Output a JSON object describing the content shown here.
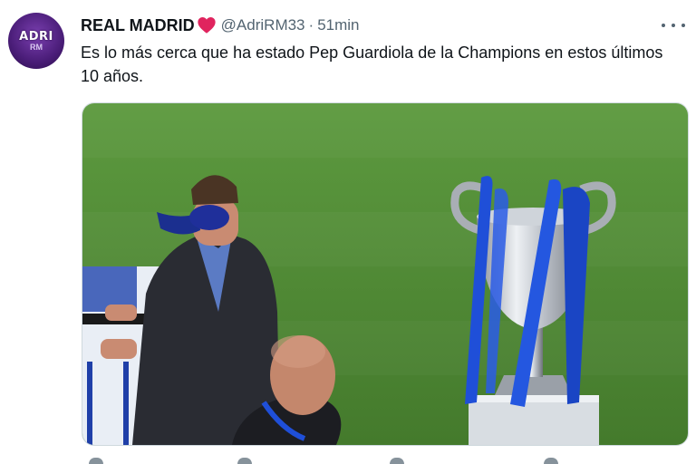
{
  "tweet": {
    "author_name": "REAL MADRID",
    "handle": "@AdriRM33",
    "separator": "·",
    "time": "51min",
    "text": "Es lo más cerca que ha estado Pep Guardiola de la Champions en estos últimos 10 años.",
    "avatar_text": "ADRI",
    "avatar_subtext": "RM"
  },
  "colors": {
    "heart": "#e0245e",
    "pitch": "#4f8a34",
    "ribbon": "#1f4fd8",
    "muted": "#536471"
  },
  "icons": [
    "heart-icon",
    "more-options-icon",
    "reply-icon",
    "retweet-icon",
    "like-icon",
    "share-icon"
  ]
}
